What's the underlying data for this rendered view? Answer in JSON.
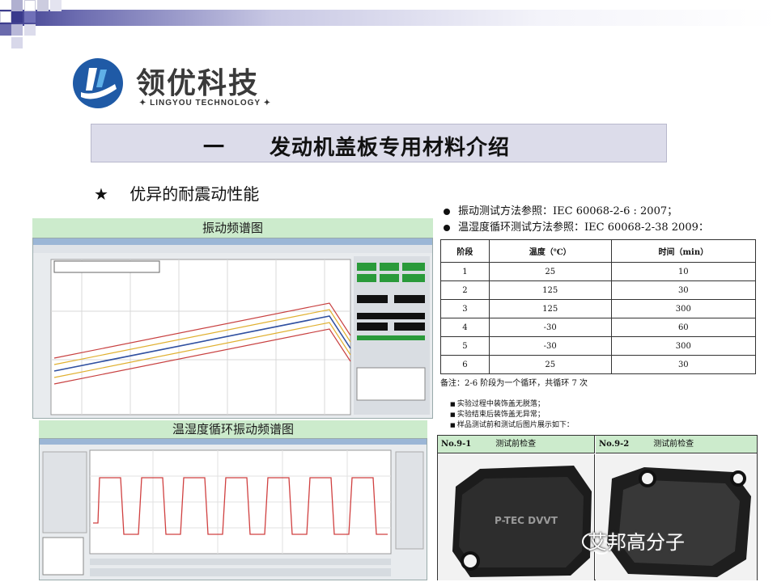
{
  "logo": {
    "name_cn": "领优科技",
    "name_en": "✦ LINGYOU TECHNOLOGY ✦"
  },
  "title": {
    "number": "一",
    "text": "发动机盖板专用材料介绍"
  },
  "feature": {
    "star": "★",
    "text": "优异的耐震动性能"
  },
  "notes": [
    "振动测试方法参照：IEC 60068-2-6 : 2007；",
    "温湿度循环测试方法参照：IEC 60068-2-38 2009："
  ],
  "vibration_panel": {
    "title": "振动频谱图"
  },
  "cycle_panel": {
    "title": "温湿度循环振动频谱图"
  },
  "stage_table": {
    "headers": [
      "阶段",
      "温度（℃）",
      "时间（min）"
    ],
    "rows": [
      [
        "1",
        "25",
        "10"
      ],
      [
        "2",
        "125",
        "30"
      ],
      [
        "3",
        "125",
        "300"
      ],
      [
        "4",
        "-30",
        "60"
      ],
      [
        "5",
        "-30",
        "300"
      ],
      [
        "6",
        "25",
        "30"
      ]
    ],
    "note": "备注：2-6 阶段为一个循环，共循环 7 次"
  },
  "checks": [
    "实验过程中装饰盖无脱落；",
    "实验结束后装饰盖无异常；",
    "样品测试前和测试后图片展示如下："
  ],
  "photos": [
    {
      "no": "No.9-1",
      "label": "测试前检查",
      "mark": "P-TEC DVVT"
    },
    {
      "no": "No.9-2",
      "label": "测试前检查"
    }
  ],
  "watermark": "艾邦高分子",
  "colors": {
    "title_bg": "#dcdcea",
    "panel_header": "#ccebcc",
    "logo_blue": "#1f5aa6"
  }
}
